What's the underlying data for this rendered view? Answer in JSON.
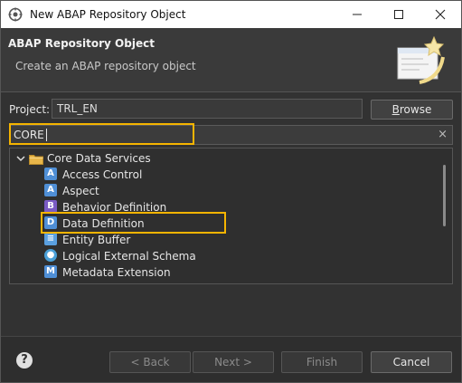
{
  "window": {
    "title": "New ABAP Repository Object"
  },
  "header": {
    "title": "ABAP Repository Object",
    "subtitle": "Create an ABAP repository object"
  },
  "project": {
    "label": "Project:",
    "value": "TRL_EN",
    "browse_label_pre": "",
    "browse_label_u": "B",
    "browse_label_post": "rowse"
  },
  "filter": {
    "value": "CORE",
    "clear_icon": "×"
  },
  "tree": {
    "folder": {
      "label": "Core Data Services",
      "icon": "folder-icon",
      "expanded": true
    },
    "items": [
      {
        "label": "Access Control",
        "icon": "access-control-icon",
        "color": "#4f8fd6",
        "glyph": "A"
      },
      {
        "label": "Aspect",
        "icon": "aspect-icon",
        "color": "#4f8fd6",
        "glyph": "A"
      },
      {
        "label": "Behavior Definition",
        "icon": "behavior-definition-icon",
        "color": "#7a5bc4",
        "glyph": "B"
      },
      {
        "label": "Data Definition",
        "icon": "data-definition-icon",
        "color": "#4f8fd6",
        "glyph": "D",
        "highlighted": true
      },
      {
        "label": "Entity Buffer",
        "icon": "entity-buffer-icon",
        "color": "#5aa0e0",
        "glyph": "≡"
      },
      {
        "label": "Logical External Schema",
        "icon": "logical-external-schema-icon",
        "color": "#4aa0d8",
        "glyph": "●"
      },
      {
        "label": "Metadata Extension",
        "icon": "metadata-extension-icon",
        "color": "#4f8fd6",
        "glyph": "M"
      }
    ]
  },
  "footer": {
    "back": "< Back",
    "next": "Next >",
    "finish": "Finish",
    "cancel": "Cancel",
    "help_icon": "?"
  },
  "colors": {
    "highlight": "#f5b400",
    "background": "#323232"
  }
}
